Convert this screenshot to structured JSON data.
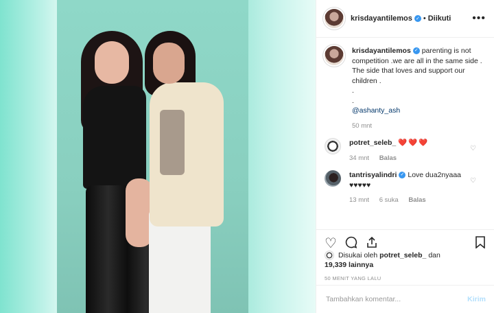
{
  "post": {
    "username": "krisdayantilemos",
    "follow_status": "Diikuti",
    "caption_lines": [
      "parenting is not competition .we are all in the same side .",
      "The side that loves and support our children .",
      ".",
      "."
    ],
    "mention": "@ashanty_ash",
    "caption_time": "50 mnt"
  },
  "comments": [
    {
      "username": "potret_seleb_",
      "text": "❤️❤️❤️",
      "time": "34 mnt",
      "reply_label": "Balas"
    },
    {
      "username": "tantrisyalindri",
      "text": "Love dua2nyaaa",
      "text2": "♥♥♥♥♥",
      "time": "13 mnt",
      "likes": "6 suka",
      "reply_label": "Balas"
    }
  ],
  "likes": {
    "prefix": "Disukai oleh",
    "user": "potret_seleb_",
    "conj": "dan",
    "count": "19,339 lainnya"
  },
  "time_ago": "50 MENIT YANG LALU",
  "add_comment": {
    "placeholder": "Tambahkan komentar...",
    "post_label": "Kirim"
  },
  "icons": [
    "more-icon",
    "heart-icon",
    "comment-icon",
    "share-icon",
    "bookmark-icon",
    "verified-icon"
  ],
  "colors": {
    "accent": "#3897f0",
    "heart": "#ed4956",
    "background_teal": "#8fd8c8"
  }
}
